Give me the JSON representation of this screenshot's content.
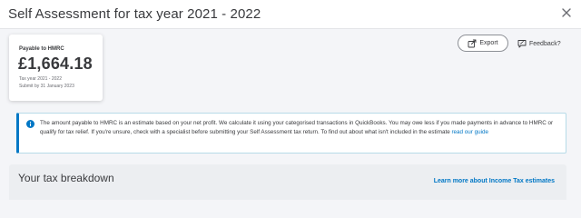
{
  "header": {
    "title": "Self Assessment for tax year 2021 - 2022",
    "close_icon": "close-icon"
  },
  "summary_card": {
    "label": "Payable to HMRC",
    "amount": "£1,664.18",
    "tax_year": "Tax year 2021 - 2022",
    "due": "Submit by 31 January 2023"
  },
  "actions": {
    "export_label": "Export",
    "export_icon": "export-icon",
    "feedback_label": "Feedback?",
    "feedback_icon": "feedback-icon"
  },
  "info_banner": {
    "icon": "info-icon",
    "text": "The amount payable to HMRC is an estimate based on your net profit. We calculate it using your categorised transactions in QuickBooks. You may owe less if you made payments in advance to HMRC or qualify for tax relief. If you're unsure, check with a specialist before submitting your Self Assessment tax return. To find out about what isn't included in the estimate",
    "link_label": "read our guide"
  },
  "breakdown": {
    "title": "Your tax breakdown",
    "link_label": "Learn more about Income Tax estimates"
  },
  "colors": {
    "accent": "#0077c5",
    "page_background": "#f4f5f8",
    "text": "#393a3d"
  }
}
